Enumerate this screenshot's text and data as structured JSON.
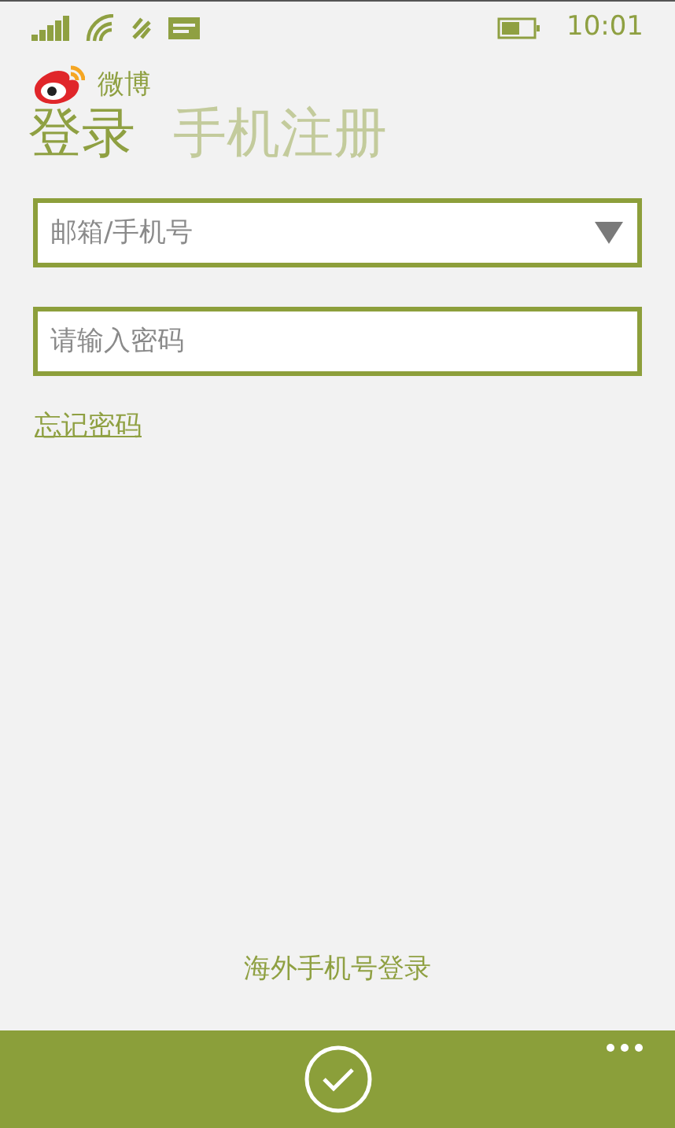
{
  "status_bar": {
    "time": "10:01"
  },
  "app": {
    "name": "微博"
  },
  "tabs": [
    {
      "label": "登录",
      "selected": true
    },
    {
      "label": "手机注册",
      "selected": false
    }
  ],
  "fields": [
    {
      "kind": "dropdown",
      "placeholder": "邮箱/手机号"
    },
    {
      "kind": "password",
      "placeholder": "请输入密码"
    }
  ],
  "forgot_link": "忘记密码",
  "overseas_link": "海外手机号登录"
}
